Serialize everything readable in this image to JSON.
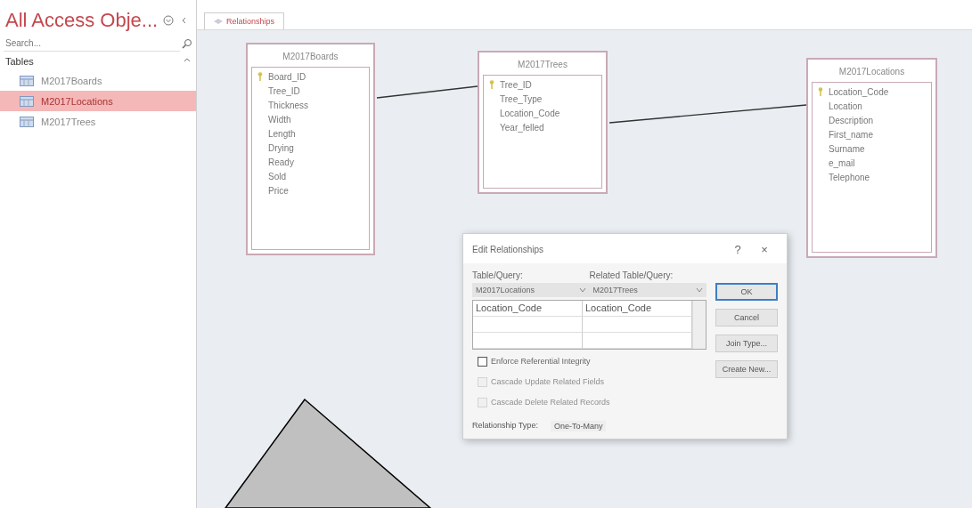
{
  "sidebar": {
    "title": "All Access Obje...",
    "search": {
      "placeholder": "Search..."
    },
    "group": "Tables",
    "items": [
      {
        "label": "M2017Boards",
        "selected": false
      },
      {
        "label": "M2017Locations",
        "selected": true
      },
      {
        "label": "M2017Trees",
        "selected": false
      }
    ]
  },
  "tabs": [
    {
      "label": "Relationships",
      "selected": true
    }
  ],
  "tables": [
    {
      "title": "M2017Boards",
      "fields": [
        {
          "name": "Board_ID",
          "key": true
        },
        {
          "name": "Tree_ID",
          "key": false
        },
        {
          "name": "Thickness",
          "key": false
        },
        {
          "name": "Width",
          "key": false
        },
        {
          "name": "Length",
          "key": false
        },
        {
          "name": "Drying",
          "key": false
        },
        {
          "name": "Ready",
          "key": false
        },
        {
          "name": "Sold",
          "key": false
        },
        {
          "name": "Price",
          "key": false
        }
      ]
    },
    {
      "title": "M2017Trees",
      "fields": [
        {
          "name": "Tree_ID",
          "key": true
        },
        {
          "name": "Tree_Type",
          "key": false
        },
        {
          "name": "Location_Code",
          "key": false
        },
        {
          "name": "Year_felled",
          "key": false
        }
      ]
    },
    {
      "title": "M2017Locations",
      "fields": [
        {
          "name": "Location_Code",
          "key": true
        },
        {
          "name": "Location",
          "key": false
        },
        {
          "name": "Description",
          "key": false
        },
        {
          "name": "First_name",
          "key": false
        },
        {
          "name": "Surname",
          "key": false
        },
        {
          "name": "e_mail",
          "key": false
        },
        {
          "name": "Telephone",
          "key": false
        }
      ]
    }
  ],
  "dialog": {
    "title": "Edit Relationships",
    "help": "?",
    "close": "×",
    "table_label": "Table/Query:",
    "related_label": "Related Table/Query:",
    "table": "M2017Locations",
    "related": "M2017Trees",
    "rows": [
      {
        "field": "Location_Code",
        "related_field": "Location_Code"
      }
    ],
    "options": [
      {
        "label": "Enforce Referential Integrity",
        "checked": false,
        "disabled": false
      },
      {
        "label": "Cascade Update Related Fields",
        "checked": false,
        "disabled": true
      },
      {
        "label": "Cascade Delete Related Records",
        "checked": false,
        "disabled": true
      }
    ],
    "type_label": "Relationship Type:",
    "type_value": "One-To-Many",
    "buttons": [
      {
        "label": "OK",
        "default": true
      },
      {
        "label": "Cancel",
        "default": false
      },
      {
        "label": "Join Type...",
        "default": false
      },
      {
        "label": "Create New...",
        "default": false
      }
    ]
  }
}
